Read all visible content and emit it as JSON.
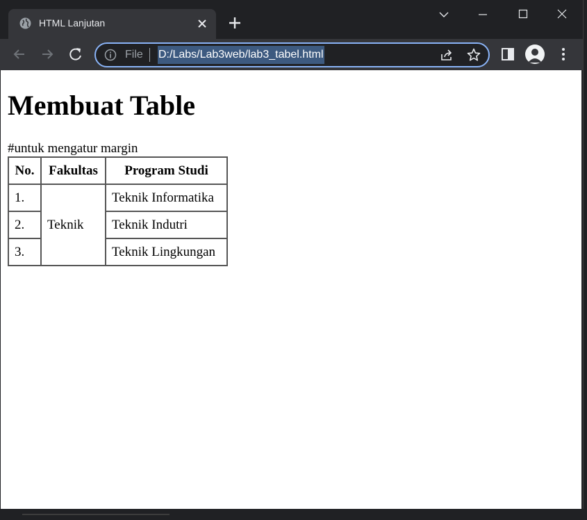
{
  "browser": {
    "tab": {
      "title": "HTML Lanjutan",
      "favicon": "globe-icon"
    },
    "new_tab_icon": "plus-icon",
    "window_controls": [
      "chevron-down-icon",
      "minimize-icon",
      "maximize-icon",
      "close-icon"
    ],
    "toolbar": {
      "back_icon": "arrow-left-icon",
      "forward_icon": "arrow-right-icon",
      "reload_icon": "reload-icon",
      "site_info_icon": "info-icon",
      "scheme_label": "File",
      "url": "D:/Labs/Lab3web/lab3_tabel.html",
      "share_icon": "share-icon",
      "bookmark_icon": "star-icon",
      "side_panel_icon": "side-panel-icon",
      "profile_icon": "avatar-icon",
      "menu_icon": "kebab-menu-icon"
    },
    "colors": {
      "frame": "#202124",
      "toolbar": "#35363a",
      "omnibox_border": "#8ab4f8",
      "url_highlight": "#3d5a80"
    }
  },
  "page": {
    "title": "Membuat Table",
    "margin_note": "#untuk mengatur margin",
    "table": {
      "headers": [
        "No.",
        "Fakultas",
        "Program Studi"
      ],
      "rows": [
        {
          "no": "1.",
          "program": "Teknik Informatika"
        },
        {
          "no": "2.",
          "program": "Teknik Indutri"
        },
        {
          "no": "3.",
          "program": "Teknik Lingkungan"
        }
      ],
      "fakultas_merged": "Teknik"
    }
  }
}
